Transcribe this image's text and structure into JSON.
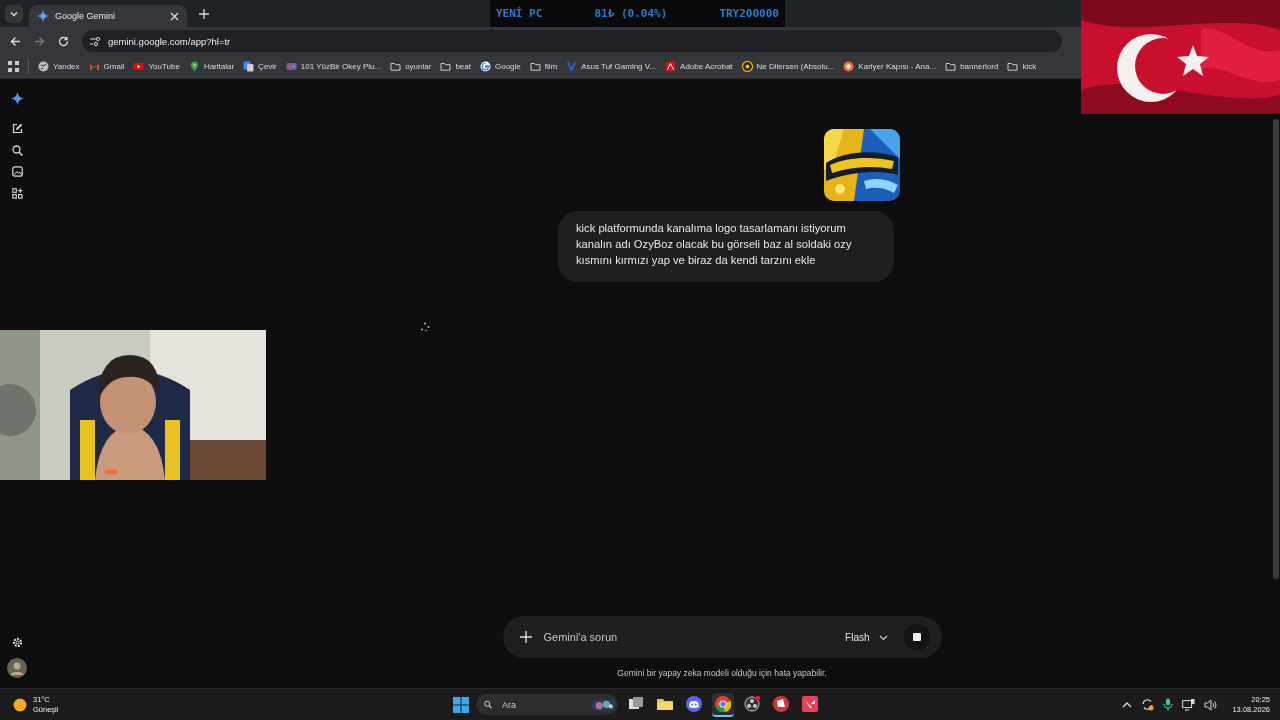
{
  "browser": {
    "tabs": [
      {
        "title": "Google Gemini",
        "selected": true
      }
    ],
    "address": "gemini.google.com/app?hl=tr",
    "bookmarks": [
      {
        "label": "Yandex",
        "kind": "globe"
      },
      {
        "label": "Gmail",
        "kind": "gmail"
      },
      {
        "label": "YouTube",
        "kind": "youtube"
      },
      {
        "label": "Haritalar",
        "kind": "maps"
      },
      {
        "label": "Çevir",
        "kind": "translate"
      },
      {
        "label": "101 YüzBir Okey Plu...",
        "kind": "game"
      },
      {
        "label": "oyunlar",
        "kind": "folder"
      },
      {
        "label": "beat",
        "kind": "folder"
      },
      {
        "label": "Google",
        "kind": "google"
      },
      {
        "label": "film",
        "kind": "folder"
      },
      {
        "label": "Asus Tuf Gaming V...",
        "kind": "asus"
      },
      {
        "label": "Adobe Acrobat",
        "kind": "acrobat"
      },
      {
        "label": "Ne Dilersen (Absolu...",
        "kind": "ring"
      },
      {
        "label": "Kariyer Kapısı - Ana...",
        "kind": "dot"
      },
      {
        "label": "bannerlord",
        "kind": "folder"
      },
      {
        "label": "kick",
        "kind": "folder"
      }
    ]
  },
  "ticker": [
    "YENİ PC",
    "81₺ (0.04%)",
    "TRY200000"
  ],
  "chat": {
    "message": "kick platformunda kanalıma logo tasarlamanı istiyorum kanalın adı OzyBoz olacak bu görseli baz al soldaki ozy kısmını kırmızı yap ve biraz da kendi tarzını ekle",
    "input_placeholder": "Gemini'a sorun",
    "model": "Flash",
    "disclaimer": "Gemini bir yapay zeka modeli olduğu için hata yapabilir."
  },
  "taskbar": {
    "temperature": "31°C",
    "condition": "Güneşli",
    "search_placeholder": "Ara",
    "apps": [
      {
        "kind": "taskview",
        "selected": false
      },
      {
        "kind": "files",
        "selected": false
      },
      {
        "kind": "discord",
        "selected": false
      },
      {
        "kind": "chrome",
        "selected": true
      },
      {
        "kind": "obs",
        "selected": false
      },
      {
        "kind": "riot",
        "selected": false
      },
      {
        "kind": "valorant",
        "selected": false
      }
    ],
    "time": "20:25",
    "date": "13.08.2026"
  }
}
